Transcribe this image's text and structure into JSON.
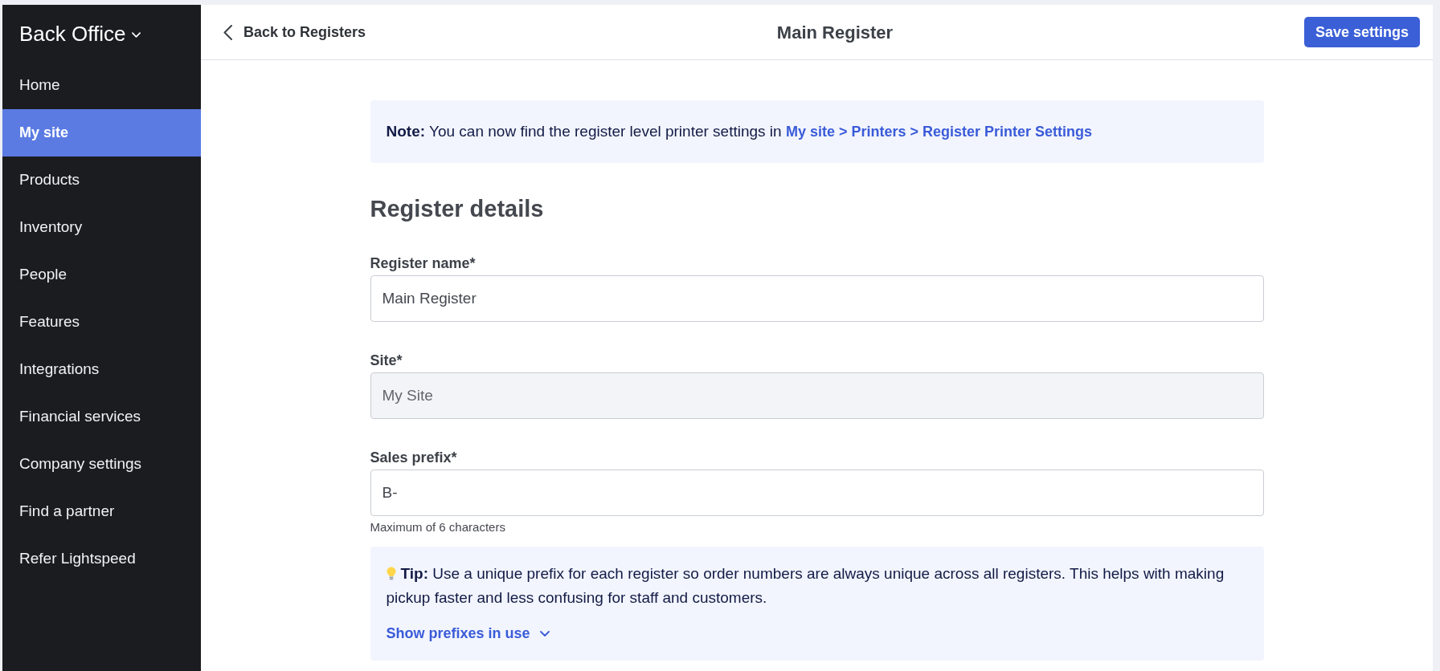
{
  "sidebar": {
    "title": "Back Office",
    "items": [
      {
        "label": "Home",
        "selected": false
      },
      {
        "label": "My site",
        "selected": true
      },
      {
        "label": "Products",
        "selected": false
      },
      {
        "label": "Inventory",
        "selected": false
      },
      {
        "label": "People",
        "selected": false
      },
      {
        "label": "Features",
        "selected": false
      },
      {
        "label": "Integrations",
        "selected": false
      },
      {
        "label": "Financial services",
        "selected": false
      },
      {
        "label": "Company settings",
        "selected": false
      },
      {
        "label": "Find a partner",
        "selected": false
      },
      {
        "label": "Refer Lightspeed",
        "selected": false
      }
    ]
  },
  "top_bar": {
    "back_link": "Back to Registers",
    "title": "Main Register",
    "save_button": "Save settings"
  },
  "note": {
    "text": "**Note:** You can now find the register level printer settings in",
    "link": "My site > Printers > Register Printer Settings"
  },
  "section_title": "Register details",
  "fields": [
    {
      "label": "Register name*",
      "value": "Main Register",
      "disabled": false
    },
    {
      "label": "Site*",
      "value": "My Site",
      "disabled": true
    },
    {
      "label": "Sales prefix*",
      "value": "B-",
      "disabled": false,
      "help": "Maximum of 6 characters"
    }
  ],
  "tip": {
    "text": "**Tip:** Use a unique prefix for each register so order numbers are always unique across all registers. This helps with making pickup faster and less confusing for staff and customers.",
    "toggle": "Show prefixes in use",
    "expanded": false
  }
}
